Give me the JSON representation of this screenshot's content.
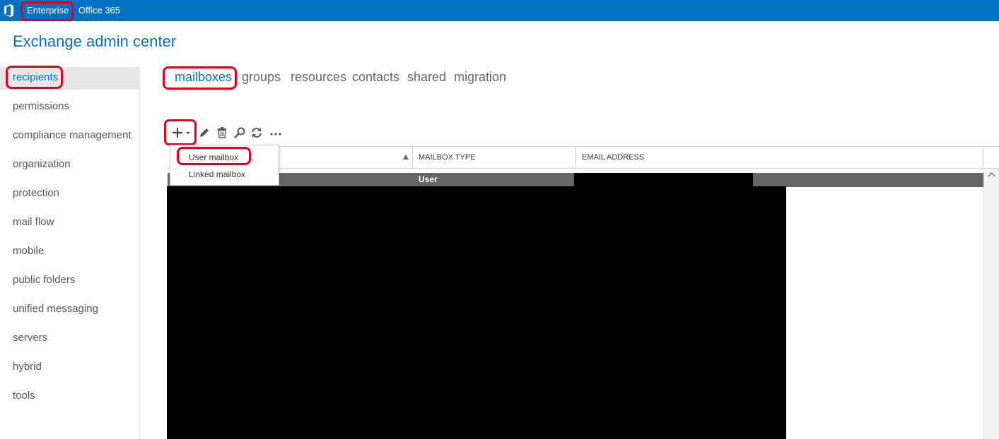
{
  "topbar": {
    "logo_icon": "office365-logo-icon",
    "links": [
      "Enterprise",
      "Office 365"
    ],
    "bg_color": "#0072c6"
  },
  "page_title": "Exchange admin center",
  "sidebar": {
    "items": [
      {
        "label": "recipients"
      },
      {
        "label": "permissions"
      },
      {
        "label": "compliance management"
      },
      {
        "label": "organization"
      },
      {
        "label": "protection"
      },
      {
        "label": "mail flow"
      },
      {
        "label": "mobile"
      },
      {
        "label": "public folders"
      },
      {
        "label": "unified messaging"
      },
      {
        "label": "servers"
      },
      {
        "label": "hybrid"
      },
      {
        "label": "tools"
      }
    ],
    "active": "recipients"
  },
  "tabs": [
    {
      "label": "mailboxes"
    },
    {
      "label": "groups"
    },
    {
      "label": "resources"
    },
    {
      "label": "contacts"
    },
    {
      "label": "shared"
    },
    {
      "label": "migration"
    }
  ],
  "toolbar": {
    "icons": [
      "add-icon",
      "edit-icon",
      "delete-icon",
      "search-icon",
      "refresh-icon",
      "more-icon"
    ]
  },
  "new_menu": {
    "items": [
      "User mailbox",
      "Linked mailbox"
    ]
  },
  "grid": {
    "columns": [
      "MAILBOX TYPE",
      "EMAIL ADDRESS"
    ],
    "selected_row": {
      "mailbox_type": "User"
    }
  },
  "colors": {
    "accent": "#0072c6",
    "highlight": "#e3001b",
    "selected_row": "#666666"
  }
}
